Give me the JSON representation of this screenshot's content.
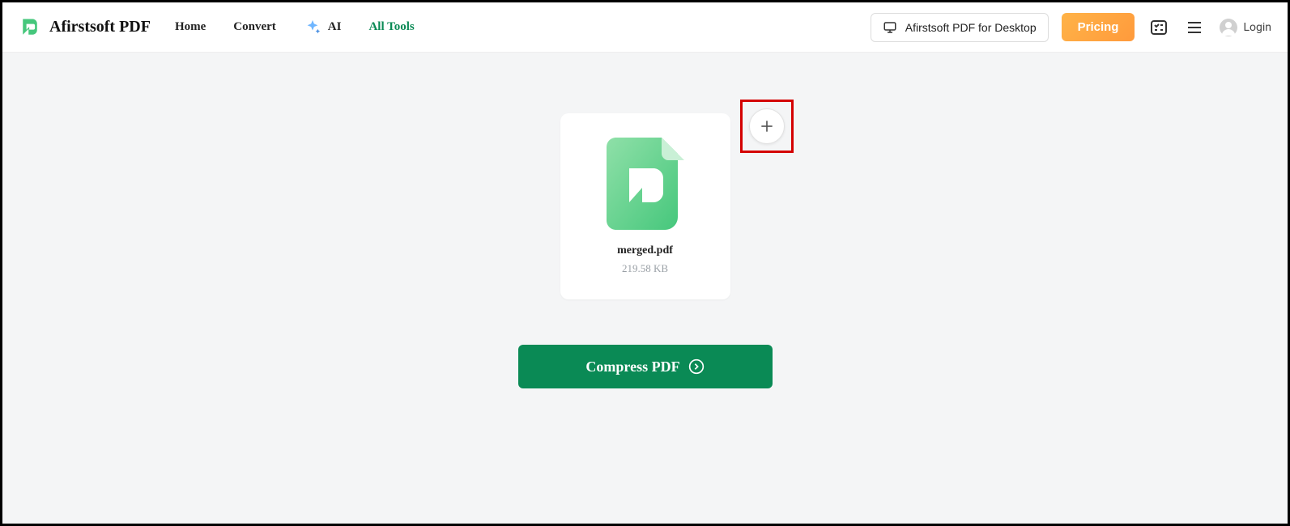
{
  "brand": {
    "name": "Afirstsoft PDF"
  },
  "nav": {
    "home": "Home",
    "convert": "Convert",
    "ai": "AI",
    "all_tools": "All Tools"
  },
  "actions": {
    "desktop_label": "Afirstsoft PDF for Desktop",
    "pricing_label": "Pricing",
    "login_label": "Login"
  },
  "file": {
    "name": "merged.pdf",
    "size": "219.58 KB"
  },
  "main": {
    "compress_label": "Compress PDF"
  },
  "colors": {
    "accent": "#0a8a55",
    "highlight": "#d40000",
    "pricing_gradient_start": "#ffb347",
    "pricing_gradient_end": "#ff9a3c"
  }
}
